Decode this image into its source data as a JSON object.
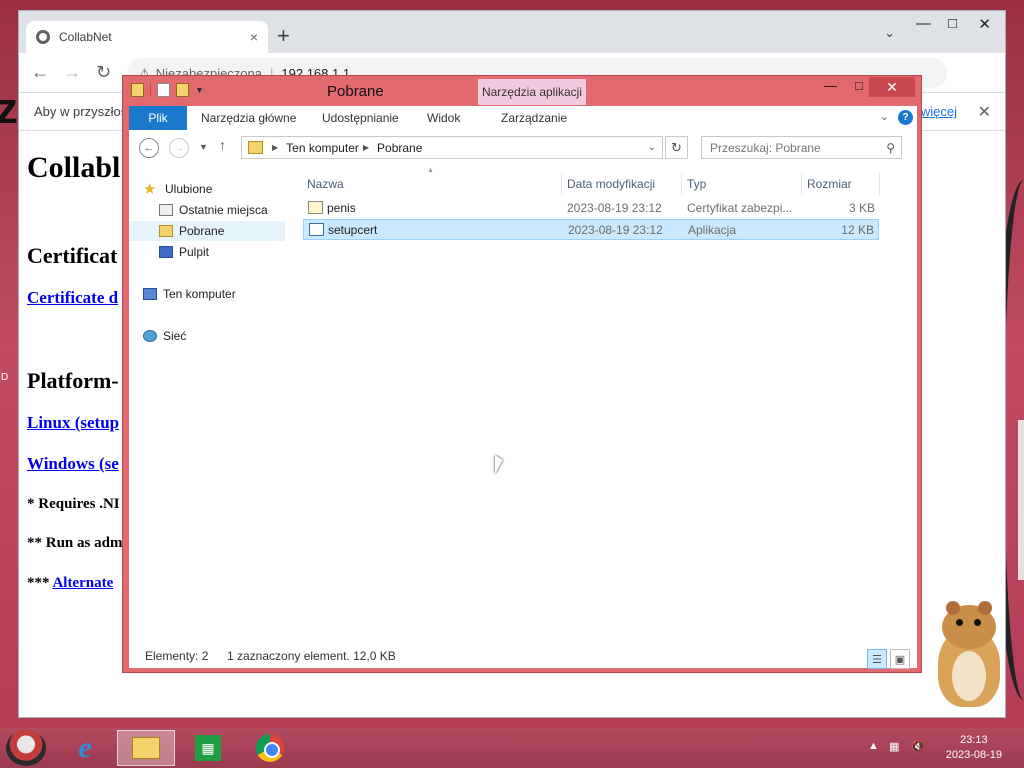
{
  "desktop": {
    "edge_letter": "z",
    "edge_label": "D"
  },
  "chrome": {
    "tab_title": "CollabNet",
    "tab_close": "×",
    "new_tab": "+",
    "tab_dropdown": "⌄",
    "omnibox_security": "Niezabezpieczona",
    "omnibox_host": "192.168.1.1",
    "infobar_text": "Aby w przyszłoś",
    "infobar_more": "więcej",
    "infobar_close": "✕"
  },
  "page": {
    "heading": "Collabl",
    "cert_heading": "Certificat",
    "cert_link": "Certificate d",
    "platform_heading": "Platform-",
    "linux_link": "Linux (setup",
    "windows_link": "Windows (se",
    "note1": "* Requires .NI",
    "note2": "** Run as adm",
    "note3_prefix": "***",
    "note3_link": "Alternate"
  },
  "explorer": {
    "title": "Pobrane",
    "context_tab": "Narzędzia aplikacji",
    "ribbon": {
      "file": "Plik",
      "tabs": [
        "Narzędzia główne",
        "Udostępnianie",
        "Widok",
        "Zarządzanie"
      ]
    },
    "address": {
      "segments": [
        "Ten komputer",
        "Pobrane"
      ]
    },
    "search_placeholder": "Przeszukaj: Pobrane",
    "nav": {
      "favorites": "Ulubione",
      "recent": "Ostatnie miejsca",
      "downloads": "Pobrane",
      "desktop": "Pulpit",
      "computer": "Ten komputer",
      "network": "Sieć"
    },
    "columns": {
      "name": "Nazwa",
      "date": "Data modyfikacji",
      "type": "Typ",
      "size": "Rozmiar"
    },
    "files": [
      {
        "name": "penis",
        "date": "2023-08-19 23:12",
        "type": "Certyfikat zabezpi...",
        "size": "3 KB",
        "icon": "certificate-icon",
        "selected": false
      },
      {
        "name": "setupcert",
        "date": "2023-08-19 23:12",
        "type": "Aplikacja",
        "size": "12 KB",
        "icon": "application-icon",
        "selected": true
      }
    ],
    "status": {
      "count": "Elementy: 2",
      "selection": "1 zaznaczony element. 12,0 KB"
    }
  },
  "taskbar": {
    "time": "23:13",
    "date": "2023-08-19",
    "ie_glyph": "e"
  },
  "colors": {
    "window_frame": "#e26a6f",
    "ribbon_file": "#1979ca",
    "selection": "#cce8ff",
    "context_tab": "#f3c9e0"
  }
}
